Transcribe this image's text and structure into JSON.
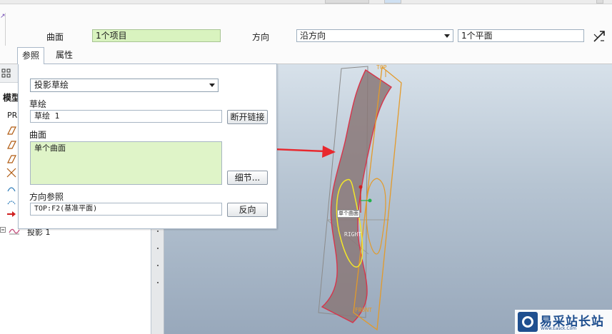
{
  "dashboard": {
    "surface_label": "曲面",
    "surface_value": "1个项目",
    "direction_label": "方向",
    "direction_value": "沿方向",
    "plane_value": "1个平面"
  },
  "tabs": [
    {
      "label": "参照",
      "active": true
    },
    {
      "label": "属性",
      "active": false
    }
  ],
  "panel": {
    "projection_type": "投影草绘",
    "sketch_label": "草绘",
    "sketch_value": "草绘 1",
    "break_link_label": "断开链接",
    "surface_label": "曲面",
    "surface_value": "单个曲面",
    "details_label": "细节...",
    "direction_ref_label": "方向参照",
    "direction_ref_value": "TOP:F2(基准平面)",
    "reverse_label": "反向"
  },
  "model_tree": {
    "header_partial": "模型",
    "root_partial": "PR",
    "bottom_item": "投影 1"
  },
  "viewport": {
    "plane_top_label": "TOP",
    "plane_right_label": "RIGHT",
    "plane_front_label": "FRONT",
    "surface_tag": "单个曲面"
  },
  "watermark": {
    "title": "易采站长站",
    "subtitle": "Www.Easck.Com"
  },
  "colors": {
    "green_field": "#d9f3bf",
    "surface_fill": "#8a7878",
    "surface_edge": "#d8344a",
    "plane_orange": "#e39a2a",
    "curve_yellow": "#f3e62a",
    "arrow_red": "#e8282e"
  }
}
